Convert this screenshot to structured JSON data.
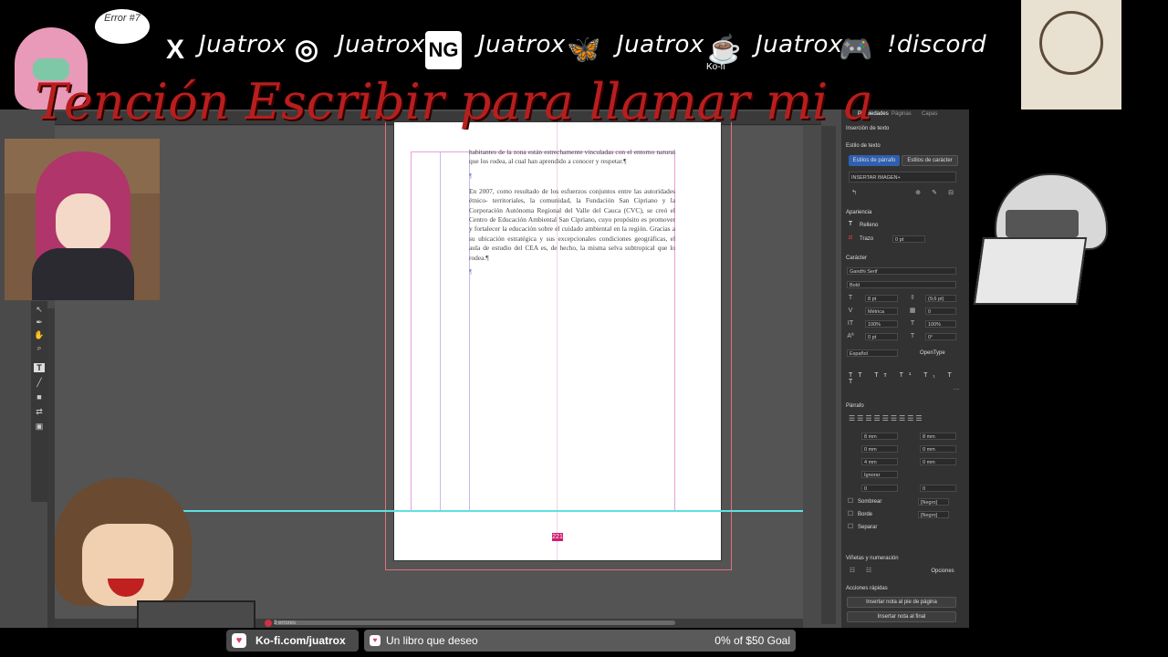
{
  "overlay": {
    "error_bubble": "Error #7",
    "socials": [
      {
        "icon": "x-icon",
        "glyph": "X",
        "handle": "Juatrox"
      },
      {
        "icon": "instagram-icon",
        "glyph": "◎",
        "handle": "Juatrox"
      },
      {
        "icon": "newgrounds-icon",
        "glyph": "NG",
        "handle": "Juatrox"
      },
      {
        "icon": "bluesky-icon",
        "glyph": "🦋",
        "handle": "Juatrox"
      },
      {
        "icon": "kofi-icon",
        "glyph": "☕",
        "handle": "Juatrox"
      },
      {
        "icon": "discord-icon",
        "glyph": "🎮",
        "handle": "!discord"
      }
    ],
    "kofi_caption": "Ko-fi",
    "marquee": "Tención Escribir para llamar mi a",
    "kofi_link": "Ko-fi.com/juatrox",
    "goal_title": "Un libro que deseo",
    "goal_progress": "0% of $50 Goal",
    "colors": {
      "marquee": "#b81e1e",
      "kofi_heart": "#e0405a"
    }
  },
  "document": {
    "paragraphs": [
      "habitantes de la zona están estrechamente vinculadas con el entorno natural que los rodea, al cual han aprendido a conocer y respetar.¶",
      "En 2007, como resultado de los esfuerzos conjuntos entre las autoridades étnico- territoriales, la comunidad, la Fundación San Cipriano y la Corporación Autónoma Regional del Valle del Cauca (CVC), se creó el Centro de Educación Ambiental San Cipriano, cuyo propósito es promover y fortalecer la educación sobre el cuidado ambiental en la región. Gracias a su ubicación estratégica y sus excepcionales condiciones geográficas, el aula de estudio del CEA es, de hecho, la misma selva subtropical que lo rodea.¶"
    ],
    "pilcrow": "¶",
    "page_number": "221",
    "errors_status": "3 errores"
  },
  "panel": {
    "tabs": [
      "Propiedades",
      "Páginas",
      "Capas"
    ],
    "section_text_insert": "Inserción de texto",
    "section_text_style": "Estilo de texto",
    "style_tab_paragraph": "Estilos de párrafo",
    "style_tab_character": "Estilos de carácter",
    "paragraph_style": "INSERTAR IMAGEN+",
    "section_appearance": "Apariencia",
    "fill_label": "Relleno",
    "stroke_label": "Trazo",
    "stroke_weight": "0 pt",
    "section_character": "Carácter",
    "font_family": "Gandhi Serif",
    "font_style": "Bold",
    "font_size": "8 pt",
    "leading": "(9,6 pt)",
    "kerning": "Métrica",
    "tracking": "0",
    "vertical_scale": "100%",
    "horizontal_scale": "100%",
    "baseline_shift": "0 pt",
    "skew": "0°",
    "language": "Español",
    "opentype": "OpenType",
    "section_paragraph": "Párrafo",
    "left_indent": "8 mm",
    "right_indent": "8 mm",
    "first_line_indent": "0 mm",
    "last_line_indent": "0 mm",
    "space_before": "4 mm",
    "space_after": "0 mm",
    "align_grid": "Ignorar",
    "drop_cap_lines": "0",
    "drop_cap_chars": "0",
    "shading_label": "Sombrear",
    "shading_color": "[Negro]",
    "border_label": "Borde",
    "border_color": "[Negro]",
    "separator_label": "Separar",
    "section_bullets": "Viñetas y numeración",
    "options_button": "Opciones",
    "section_quick_actions": "Acciones rápidas",
    "footnote_button": "Insertar nota al pie de página",
    "endnote_button": "Insertar nota al final"
  }
}
